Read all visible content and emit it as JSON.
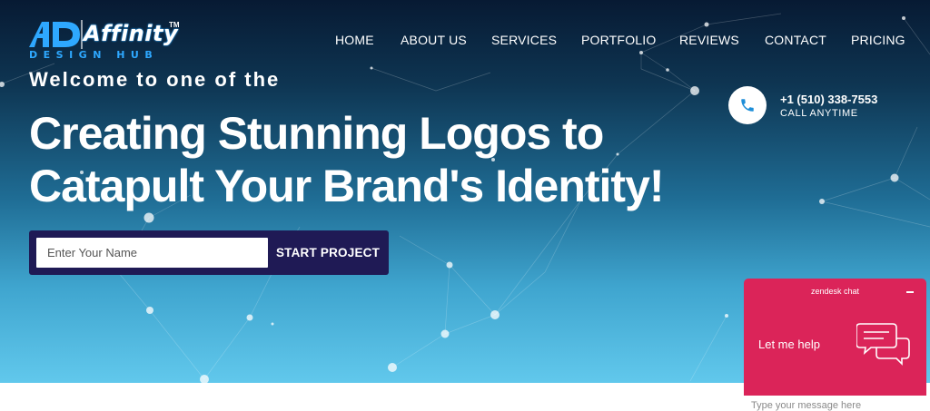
{
  "brand": {
    "name": "Affinity",
    "trademark": "TM",
    "tagline": "DESIGN HUB"
  },
  "nav": {
    "items": [
      "HOME",
      "ABOUT US",
      "SERVICES",
      "PORTFOLIO",
      "REVIEWS",
      "CONTACT",
      "PRICING"
    ]
  },
  "hero": {
    "welcome": "Welcome to one of the",
    "headline_line1": "Creating Stunning Logos to",
    "headline_line2": "Catapult Your Brand's Identity!"
  },
  "form": {
    "name_placeholder": "Enter Your Name",
    "name_value": "",
    "submit_label": "START PROJECT"
  },
  "contact": {
    "phone": "+1 (510) 338-7553",
    "caption": "CALL ANYTIME"
  },
  "chat_widget": {
    "title": "zendesk chat",
    "prompt": "Let me help",
    "input_placeholder": "Type your message here"
  },
  "colors": {
    "hero_top": "#071a33",
    "hero_bottom": "#61c8ec",
    "form_bg": "#1f1a55",
    "chat_accent": "#db2459",
    "logo_blue": "#2ea8ff"
  },
  "icons": {
    "logo_mark": "ad-monogram-icon",
    "phone": "phone-icon",
    "chat": "chat-bubbles-icon",
    "minimize": "minimize-icon"
  }
}
